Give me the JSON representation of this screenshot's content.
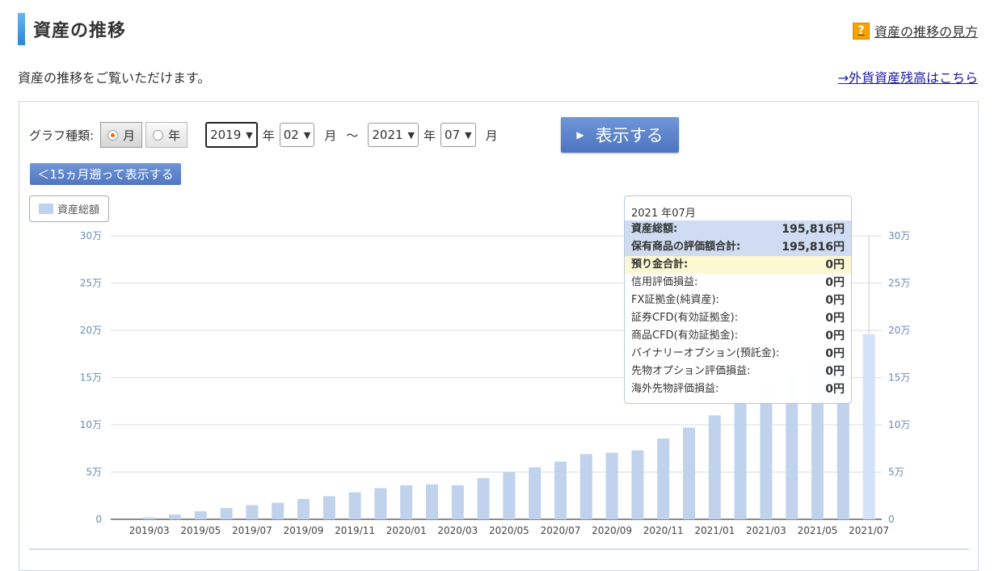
{
  "header": {
    "title": "資産の推移",
    "help_link": "資産の推移の見方",
    "help_icon": "?",
    "description": "資産の推移をご覧いただけます。",
    "fx_link": "→外貨資産残高はこちら"
  },
  "controls": {
    "graph_type_label": "グラフ種類:",
    "radio_month": "月",
    "radio_year": "年",
    "selected": "月",
    "from_year": "2019",
    "from_month": "02",
    "to_year": "2021",
    "to_month": "07",
    "year_unit": "年",
    "month_unit": "月",
    "range_sep": "～",
    "show_button": "表示する",
    "back_button": "＜15ヵ月遡って表示する"
  },
  "legend": {
    "label": "資産総額",
    "color": "#c0d2ec"
  },
  "tooltip": {
    "date": "2021 年07月",
    "rows": [
      {
        "label": "資産総額:",
        "value": "195,816円",
        "style": "blue"
      },
      {
        "label": "保有商品の評価額合計:",
        "value": "195,816円",
        "style": "blue"
      },
      {
        "label": "預り金合計:",
        "value": "0円",
        "style": "yellow"
      },
      {
        "label": "信用評価損益:",
        "value": "0円",
        "style": ""
      },
      {
        "label": "FX証拠金(純資産):",
        "value": "0円",
        "style": ""
      },
      {
        "label": "証券CFD(有効証拠金):",
        "value": "0円",
        "style": ""
      },
      {
        "label": "商品CFD(有効証拠金):",
        "value": "0円",
        "style": ""
      },
      {
        "label": "バイナリーオプション(預託金):",
        "value": "0円",
        "style": ""
      },
      {
        "label": "先物オプション評価損益:",
        "value": "0円",
        "style": ""
      },
      {
        "label": "海外先物評価損益:",
        "value": "0円",
        "style": ""
      }
    ]
  },
  "chart_data": {
    "type": "bar",
    "categories": [
      "2019/02",
      "2019/03",
      "2019/04",
      "2019/05",
      "2019/06",
      "2019/07",
      "2019/08",
      "2019/09",
      "2019/10",
      "2019/11",
      "2019/12",
      "2020/01",
      "2020/02",
      "2020/03",
      "2020/04",
      "2020/05",
      "2020/06",
      "2020/07",
      "2020/08",
      "2020/09",
      "2020/10",
      "2020/11",
      "2020/12",
      "2021/01",
      "2021/02",
      "2021/03",
      "2021/04",
      "2021/05",
      "2021/06",
      "2021/07"
    ],
    "x_tick_labels": [
      "2019/03",
      "2019/05",
      "2019/07",
      "2019/09",
      "2019/11",
      "2020/01",
      "2020/03",
      "2020/05",
      "2020/07",
      "2020/09",
      "2020/11",
      "2021/01",
      "2021/03",
      "2021/05",
      "2021/07"
    ],
    "values": [
      0,
      2000,
      5000,
      8500,
      12000,
      15000,
      17500,
      21500,
      24500,
      28500,
      33000,
      36000,
      37000,
      36000,
      43500,
      50000,
      55000,
      61000,
      69000,
      70500,
      73000,
      85500,
      97000,
      110000,
      126000,
      142000,
      158000,
      170000,
      183000,
      195816
    ],
    "ylim": [
      0,
      300000
    ],
    "yticks": [
      0,
      50000,
      100000,
      150000,
      200000,
      250000,
      300000
    ],
    "ytick_labels": [
      "0",
      "5万",
      "10万",
      "15万",
      "20万",
      "25万",
      "30万"
    ],
    "highlight_index": 29,
    "bar_color": "#c0d2ec",
    "highlight_color": "#d3e2f8",
    "grid": true,
    "series_name": "資産総額"
  }
}
